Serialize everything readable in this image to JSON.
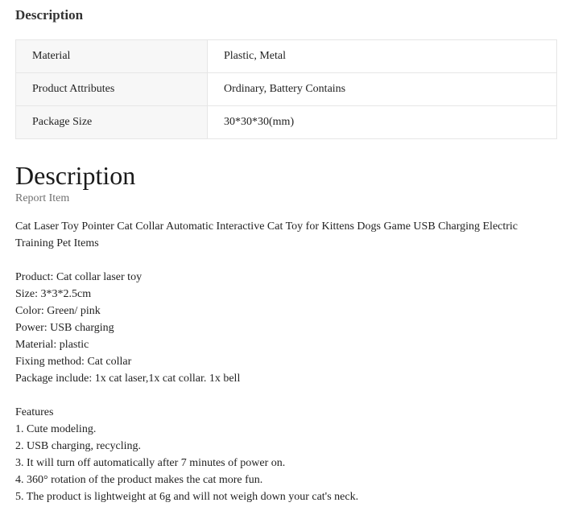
{
  "top_heading": "Description",
  "attributes": [
    {
      "label": "Material",
      "value": "Plastic, Metal"
    },
    {
      "label": "Product Attributes",
      "value": "Ordinary, Battery Contains"
    },
    {
      "label": "Package Size",
      "value": "30*30*30(mm)"
    }
  ],
  "description": {
    "heading": "Description",
    "report_link": "Report Item",
    "title": "Cat Laser Toy Pointer Cat Collar Automatic Interactive Cat Toy for Kittens Dogs Game USB Charging Electric Training Pet Items",
    "specs": [
      "Product: Cat collar laser toy",
      "Size: 3*3*2.5cm",
      "Color: Green/ pink",
      "Power: USB charging",
      "Material: plastic",
      "Fixing method: Cat collar",
      "Package include: 1x cat laser,1x cat collar. 1x bell"
    ],
    "features_heading": "Features",
    "features": [
      "1. Cute modeling.",
      "2. USB charging, recycling.",
      "3. It will turn off automatically after 7 minutes of power on.",
      "4. 360° rotation of the product makes the cat more fun.",
      "5. The product is lightweight at 6g and will not weigh down your cat's neck."
    ]
  }
}
